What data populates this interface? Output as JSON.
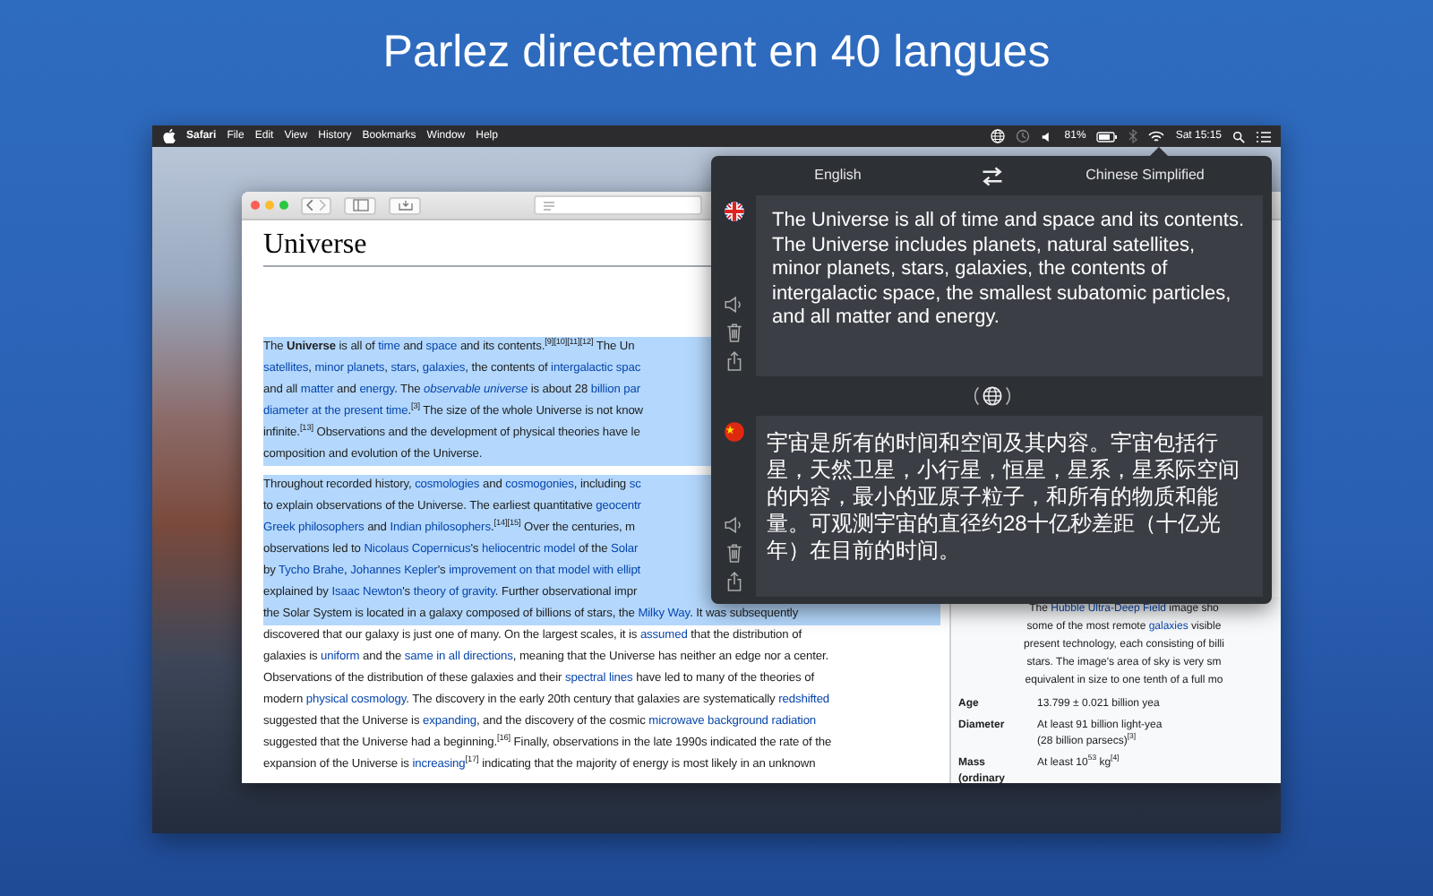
{
  "headline": "Parlez directement en 40 langues",
  "menu_bar": {
    "app": "Safari",
    "menus": [
      "File",
      "Edit",
      "View",
      "History",
      "Bookmarks",
      "Window",
      "Help"
    ],
    "battery": "81%",
    "clock": "Sat 15:15"
  },
  "browser": {
    "article_title": "Universe",
    "paragraphs": [
      {
        "lines": [
          {
            "highlighted": true,
            "segments": [
              {
                "text": "The **Universe** is all of ",
                "link": false
              },
              {
                "text": "time",
                "link": true
              },
              {
                "text": " and ",
                "link": false
              },
              {
                "text": "space",
                "link": true
              },
              {
                "text": " and its contents.$^{[9][10][11][12]}$ The Un",
                "link": false
              }
            ]
          },
          {
            "highlighted": true,
            "segments": [
              {
                "text": "satellites",
                "link": true
              },
              {
                "text": ", ",
                "link": false
              },
              {
                "text": "minor planets",
                "link": true
              },
              {
                "text": ", ",
                "link": false
              },
              {
                "text": "stars",
                "link": true
              },
              {
                "text": ", ",
                "link": false
              },
              {
                "text": "galaxies",
                "link": true
              },
              {
                "text": ", the contents of ",
                "link": false
              },
              {
                "text": "intergalactic spac",
                "link": true
              }
            ]
          },
          {
            "highlighted": true,
            "segments": [
              {
                "text": "and all ",
                "link": false
              },
              {
                "text": "matter",
                "link": true
              },
              {
                "text": " and ",
                "link": false
              },
              {
                "text": "energy",
                "link": true
              },
              {
                "text": ". The ",
                "link": false
              },
              {
                "text": "*observable universe*",
                "link": true
              },
              {
                "text": " is about 28 ",
                "link": false
              },
              {
                "text": "billion par",
                "link": true
              }
            ]
          },
          {
            "highlighted": true,
            "segments": [
              {
                "text": "diameter at the present time",
                "link": true
              },
              {
                "text": ".$^{[3]}$ The size of the whole Universe is not know",
                "link": false
              }
            ]
          },
          {
            "highlighted": true,
            "segments": [
              {
                "text": "infinite.$^{[13]}$ Observations and the development of physical theories have le",
                "link": false
              }
            ]
          },
          {
            "highlighted": true,
            "segments": [
              {
                "text": "composition and evolution of the Universe.",
                "link": false
              }
            ]
          }
        ]
      },
      {
        "lines": [
          {
            "highlighted": true,
            "segments": [
              {
                "text": "Throughout recorded history, ",
                "link": false
              },
              {
                "text": "cosmologies",
                "link": true
              },
              {
                "text": " and ",
                "link": false
              },
              {
                "text": "cosmogonies",
                "link": true
              },
              {
                "text": ", including ",
                "link": false
              },
              {
                "text": "sc",
                "link": true
              }
            ]
          },
          {
            "highlighted": true,
            "segments": [
              {
                "text": "to explain observations of the Universe. The earliest quantitative ",
                "link": false
              },
              {
                "text": "geocentr",
                "link": true
              }
            ]
          },
          {
            "highlighted": true,
            "segments": [
              {
                "text": "Greek philosophers",
                "link": true
              },
              {
                "text": " and ",
                "link": false
              },
              {
                "text": "Indian philosophers",
                "link": true
              },
              {
                "text": ".$^{[14][15]}$ Over the centuries, m",
                "link": false
              }
            ]
          },
          {
            "highlighted": true,
            "segments": [
              {
                "text": "observations led to ",
                "link": false
              },
              {
                "text": "Nicolaus Copernicus",
                "link": true
              },
              {
                "text": "'s ",
                "link": false
              },
              {
                "text": "heliocentric model",
                "link": true
              },
              {
                "text": " of the ",
                "link": false
              },
              {
                "text": "Solar",
                "link": true
              }
            ]
          },
          {
            "highlighted": true,
            "segments": [
              {
                "text": "by ",
                "link": false
              },
              {
                "text": "Tycho Brahe",
                "link": true
              },
              {
                "text": ", ",
                "link": false
              },
              {
                "text": "Johannes Kepler",
                "link": true
              },
              {
                "text": "'s ",
                "link": false
              },
              {
                "text": "improvement on that model with ellipt",
                "link": true
              }
            ]
          },
          {
            "highlighted": true,
            "segments": [
              {
                "text": "explained by ",
                "link": false
              },
              {
                "text": "Isaac Newton",
                "link": true
              },
              {
                "text": "'s ",
                "link": false
              },
              {
                "text": "theory of gravity",
                "link": true
              },
              {
                "text": ". Further observational impr",
                "link": false
              }
            ]
          },
          {
            "highlighted": true,
            "segments": [
              {
                "text": "the Solar System is located in a galaxy composed of billions of stars, the ",
                "link": false
              },
              {
                "text": "Milky Way",
                "link": true
              },
              {
                "text": ". It was subsequently",
                "link": false
              }
            ]
          },
          {
            "highlighted": false,
            "segments": [
              {
                "text": "discovered that our galaxy is just one of many. On the largest scales, it is ",
                "link": false
              },
              {
                "text": "assumed",
                "link": true
              },
              {
                "text": " that the distribution of",
                "link": false
              }
            ]
          },
          {
            "highlighted": false,
            "segments": [
              {
                "text": "galaxies is ",
                "link": false
              },
              {
                "text": "uniform",
                "link": true
              },
              {
                "text": " and the ",
                "link": false
              },
              {
                "text": "same in all directions",
                "link": true
              },
              {
                "text": ", meaning that the Universe has neither an edge nor a center.",
                "link": false
              }
            ]
          },
          {
            "highlighted": false,
            "segments": [
              {
                "text": "Observations of the distribution of these galaxies and their ",
                "link": false
              },
              {
                "text": "spectral lines",
                "link": true
              },
              {
                "text": " have led to many of the theories of",
                "link": false
              }
            ]
          },
          {
            "highlighted": false,
            "segments": [
              {
                "text": "modern ",
                "link": false
              },
              {
                "text": "physical cosmology",
                "link": true
              },
              {
                "text": ". The discovery in the early 20th century that galaxies are systematically ",
                "link": false
              },
              {
                "text": "redshifted",
                "link": true
              }
            ]
          },
          {
            "highlighted": false,
            "segments": [
              {
                "text": "suggested that the Universe is ",
                "link": false
              },
              {
                "text": "expanding",
                "link": true
              },
              {
                "text": ", and the discovery of the cosmic ",
                "link": false
              },
              {
                "text": "microwave background radiation",
                "link": true
              }
            ]
          },
          {
            "highlighted": false,
            "segments": [
              {
                "text": "suggested that the Universe had a beginning.$^{[16]}$ Finally, observations in the late 1990s indicated the rate of the",
                "link": false
              }
            ]
          },
          {
            "highlighted": false,
            "segments": [
              {
                "text": "expansion of the Universe is ",
                "link": false
              },
              {
                "text": "increasing",
                "link": true
              },
              {
                "text": "$^{[17]}$ indicating that the majority of energy is most likely in an unknown",
                "link": false
              }
            ]
          }
        ]
      }
    ],
    "infobox": {
      "caption_lines": [
        {
          "segments": [
            {
              "text": "The ",
              "link": false
            },
            {
              "text": "Hubble Ultra-Deep Field",
              "link": true
            },
            {
              "text": " image sho",
              "link": false
            }
          ]
        },
        {
          "segments": [
            {
              "text": "some of the most remote ",
              "link": false
            },
            {
              "text": "galaxies",
              "link": true
            },
            {
              "text": " visible",
              "link": false
            }
          ]
        },
        {
          "segments": [
            {
              "text": "present technology, each consisting of billi",
              "link": false
            }
          ]
        },
        {
          "segments": [
            {
              "text": "stars. The image's area of sky is very sm",
              "link": false
            }
          ]
        },
        {
          "segments": [
            {
              "text": "equivalent in size to one tenth of a full mo",
              "link": false
            }
          ]
        }
      ],
      "rows": [
        {
          "label": "Age",
          "values": [
            "13.799 ± 0.021 billion yea"
          ]
        },
        {
          "label": "Diameter",
          "values": [
            "At least 91 billion light-yea",
            "(28 billion parsecs)$^{[3]}$"
          ]
        },
        {
          "label": "Mass (ordinary",
          "values": [
            "At least 10$^{53}$ kg$^{[4]}$"
          ]
        }
      ]
    }
  },
  "translator": {
    "source_language": "English",
    "target_language": "Chinese Simplified",
    "source_text": "The Universe is all of time and space and its contents. The Universe includes planets, natural satellites, minor planets, stars, galaxies, the contents of intergalactic space, the smallest subatomic particles, and all matter and energy.",
    "target_text": "宇宙是所有的时间和空间及其内容。宇宙包括行星，天然卫星，小行星，恒星，星系，星系际空间的内容，最小的亚原子粒子，和所有的物质和能量。可观测宇宙的直径约28十亿秒差距（十亿光年）在目前的时间。"
  }
}
